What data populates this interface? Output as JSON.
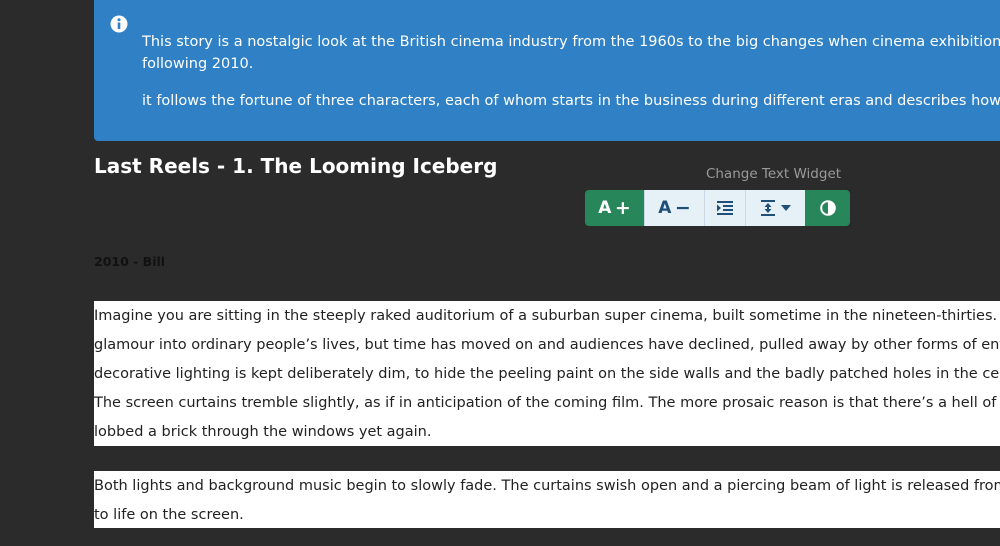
{
  "info": {
    "icon": "info-circle-icon",
    "paragraph1_line1": "This story is a nostalgic look at the British cinema industry from the 1960s to the big changes when cinema exhibition abandoned",
    "paragraph1_line2": "following 2010.",
    "paragraph2": "it follows the fortune of three characters, each of whom starts in the business during different eras and describes how they cope"
  },
  "story": {
    "title": "Last Reels - 1. The Looming Iceberg",
    "section_heading": "2010 - Bill"
  },
  "widget": {
    "tooltip": "Change Text Widget",
    "increase_label": "A",
    "increase_sign": "+",
    "decrease_label": "A",
    "decrease_sign": "−",
    "icons": [
      "indent-icon",
      "line-spacing-icon",
      "caret-down-icon",
      "contrast-icon"
    ],
    "colors": {
      "green": "#27875a",
      "light": "#e6f0f7",
      "icon_dark": "#1f4f78"
    }
  },
  "paragraphs": [
    {
      "lines": [
        " Imagine you are sitting in the steeply raked auditorium of a suburban super cinema, built sometime in the nineteen-thirties. Back then, it",
        "glamour into ordinary people’s lives, but time has moved on and audiences have declined, pulled away by other forms of entertainment.",
        "decorative lighting is kept deliberately dim, to hide the peeling paint on the side walls and the badly patched holes in the ceiling where a",
        "The screen curtains tremble slightly, as if in anticipation of the coming film. The more prosaic reason is that there’s a hell of a draught com",
        "lobbed a brick through the windows yet again."
      ]
    },
    {
      "lines": [
        "Both lights and background music begin to slowly fade. The curtains swish open and a piercing beam of light is released from the small",
        "to life on the screen."
      ]
    }
  ],
  "colors": {
    "background": "#2b2b2b",
    "info_banner": "#2f80c4"
  }
}
